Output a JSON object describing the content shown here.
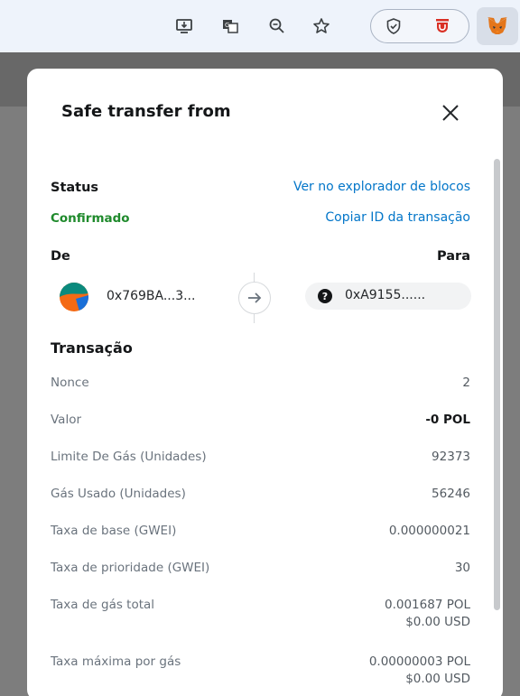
{
  "toolbar": {
    "icons": [
      "install-app-icon",
      "translate-icon",
      "zoom-icon",
      "bookmark-star-icon",
      "shield-extension-icon",
      "ublock-extension-icon",
      "metamask-fox-icon"
    ]
  },
  "modal": {
    "title": "Safe transfer from",
    "status_label": "Status",
    "status_value": "Confirmado",
    "explorer_link": "Ver no explorador de blocos",
    "copy_link": "Copiar ID da transação",
    "from_label": "De",
    "to_label": "Para",
    "from_address": "0x769BA...3...",
    "to_address": "0xA9155......",
    "to_badge": "?",
    "section_title": "Transação",
    "rows": [
      {
        "label": "Nonce",
        "value": "2"
      },
      {
        "label": "Valor",
        "value": "-0 POL"
      },
      {
        "label": "Limite De Gás (Unidades)",
        "value": "92373"
      },
      {
        "label": "Gás Usado (Unidades)",
        "value": "56246"
      },
      {
        "label": "Taxa de base (GWEI)",
        "value": "0.000000021"
      },
      {
        "label": "Taxa de prioridade (GWEI)",
        "value": "30"
      },
      {
        "label": "Taxa de gás total",
        "value": "0.001687 POL",
        "value2": "$0.00 USD"
      },
      {
        "label": "Taxa máxima por gás",
        "value": "0.00000003 POL",
        "value2": "$0.00 USD"
      }
    ]
  },
  "colors": {
    "link": "#0376c9",
    "confirmed": "#1f8a2c",
    "backdrop": "#7d7d7d"
  }
}
